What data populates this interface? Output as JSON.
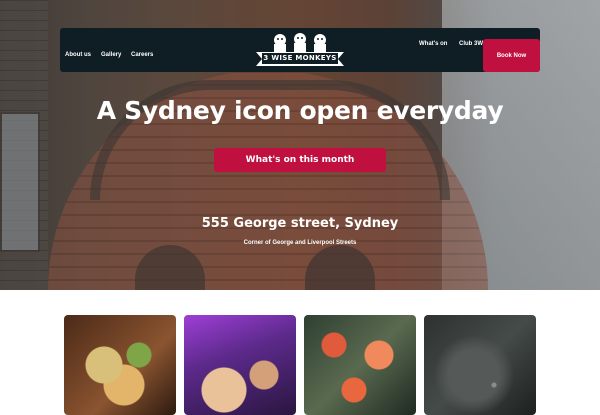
{
  "nav": {
    "left_links": [
      "About us",
      "Gallery",
      "Careers"
    ],
    "right_links": [
      "What's on",
      "Club 3W"
    ],
    "logo_text": "3 WISE MONKEYS",
    "book_label": "Book Now"
  },
  "hero": {
    "title": "A Sydney icon open everyday",
    "cta_label": "What's on this month",
    "address": "555 George street, Sydney",
    "address_sub": "Corner of George and Liverpool Streets"
  },
  "colors": {
    "nav_bg": "#0f1d24",
    "accent": "#c0103f",
    "text": "#ffffff"
  },
  "cards": [
    {
      "name": "food-photo"
    },
    {
      "name": "party-photo"
    },
    {
      "name": "sushi-photo"
    },
    {
      "name": "venue-photo"
    }
  ]
}
